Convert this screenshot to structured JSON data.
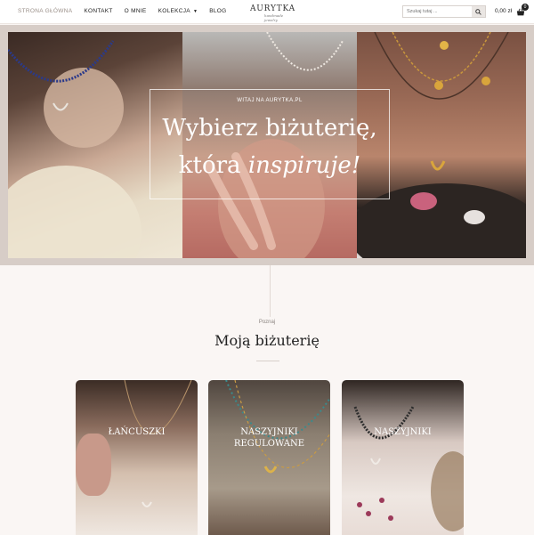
{
  "header": {
    "nav": [
      {
        "label": "STRONA GŁÓWNA"
      },
      {
        "label": "KONTAKT"
      },
      {
        "label": "O MNIE"
      },
      {
        "label": "KOLEKCJA"
      },
      {
        "label": "BLOG"
      }
    ],
    "logo": {
      "text": "AURYTKA",
      "script": "handmade jewelry"
    },
    "search": {
      "placeholder": "Szukaj tutaj ..."
    },
    "cart": {
      "total": "0,00 zł",
      "count": "0"
    }
  },
  "hero": {
    "subtitle": "WITAJ NA AURYTKA.PL",
    "line1": "Wybierz biżuterię,",
    "line2_main": "która ",
    "line2_script": "inspiruje!"
  },
  "section": {
    "kicker": "Poznaj",
    "title": "Moją biżuterię"
  },
  "categories": [
    {
      "label": "ŁAŃCUSZKI"
    },
    {
      "label": "NASZYJNIKI REGULOWANE"
    },
    {
      "label": "NASZYJNIKI"
    }
  ],
  "colors": {
    "active_nav": "#9a8f88",
    "background": "#faf6f4",
    "hero_frame": "#d7cdc7"
  }
}
